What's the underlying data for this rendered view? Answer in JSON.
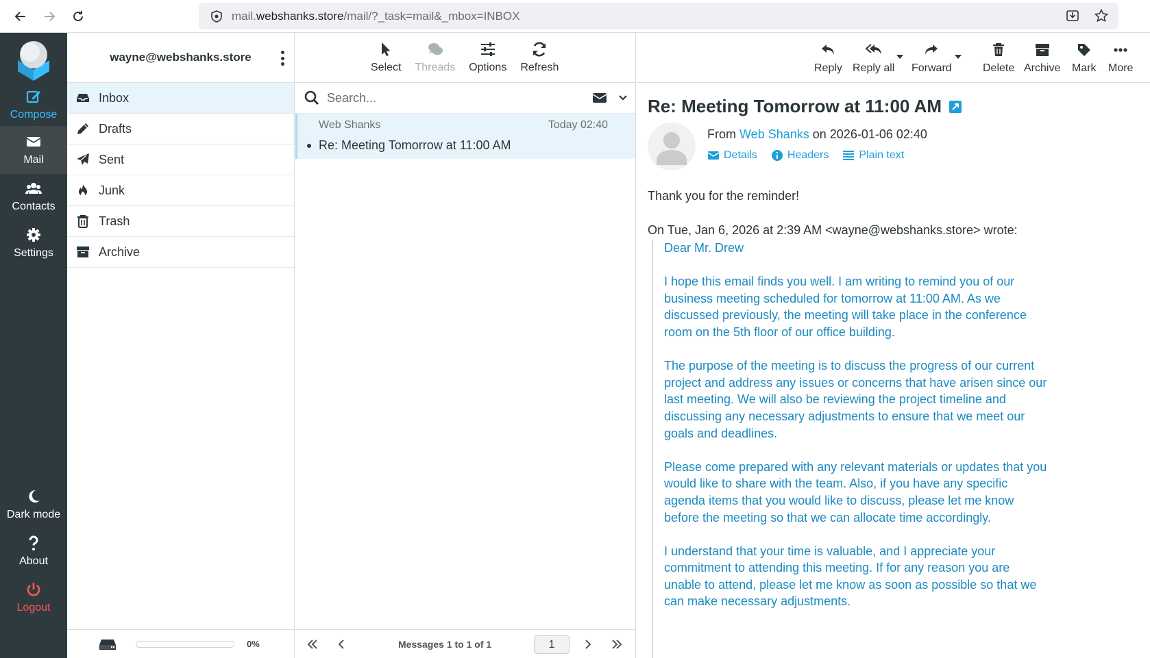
{
  "browser": {
    "url_prefix": "mail.",
    "url_domain": "webshanks.store",
    "url_suffix": "/mail/?_task=mail&_mbox=INBOX"
  },
  "rail": {
    "compose": "Compose",
    "mail": "Mail",
    "contacts": "Contacts",
    "settings": "Settings",
    "dark_mode": "Dark mode",
    "about": "About",
    "logout": "Logout"
  },
  "folders": {
    "account": "wayne@webshanks.store",
    "items": [
      {
        "label": "Inbox",
        "icon": "inbox-icon"
      },
      {
        "label": "Drafts",
        "icon": "pencil-icon"
      },
      {
        "label": "Sent",
        "icon": "paper-plane-icon"
      },
      {
        "label": "Junk",
        "icon": "fire-icon"
      },
      {
        "label": "Trash",
        "icon": "trash-icon"
      },
      {
        "label": "Archive",
        "icon": "archive-icon"
      }
    ],
    "quota_text": "0%",
    "quota_fraction": 0
  },
  "list": {
    "toolbar": {
      "select": "Select",
      "threads": "Threads",
      "options": "Options",
      "refresh": "Refresh"
    },
    "search_placeholder": "Search...",
    "messages": [
      {
        "from": "Web Shanks",
        "date": "Today 02:40",
        "subject": "Re: Meeting Tomorrow at 11:00 AM"
      }
    ],
    "pager_text": "Messages 1 to 1 of 1",
    "page": "1"
  },
  "view": {
    "toolbar": {
      "reply": "Reply",
      "reply_all": "Reply all",
      "forward": "Forward",
      "delete": "Delete",
      "archive": "Archive",
      "mark": "Mark",
      "more": "More"
    },
    "subject": "Re: Meeting Tomorrow at 11:00 AM",
    "from_prefix": "From",
    "from_name": "Web Shanks",
    "from_suffix": "on 2026-01-06 02:40",
    "links": {
      "details": "Details",
      "headers": "Headers",
      "plain_text": "Plain text"
    },
    "body": "Thank you for the reminder!",
    "quote_intro": "On Tue, Jan 6, 2026 at 2:39 AM <wayne@webshanks.store> wrote:",
    "quote": {
      "greeting": "Dear Mr. Drew",
      "p1": "I hope this email finds you well. I am writing to remind you of our business meeting scheduled for tomorrow at 11:00 AM. As we discussed previously, the meeting will take place in the conference room on the 5th floor of our office building.",
      "p2": "The purpose of the meeting is to discuss the progress of our current project and address any issues or concerns that have arisen since our last meeting. We will also be reviewing the project timeline and discussing any necessary adjustments to ensure that we meet our goals and deadlines.",
      "p3": "Please come prepared with any relevant materials or updates that you would like to share with the team. Also, if you have any specific agenda items that you would like to discuss, please let me know before the meeting so that we can allocate time accordingly.",
      "p4": "I understand that your time is valuable, and I appreciate your commitment to attending this meeting. If for any reason you are unable to attend, please let me know as soon as possible so that we can make necessary adjustments."
    }
  },
  "colors": {
    "rail_bg": "#2f3a3f",
    "accent": "#37beff",
    "link": "#1d9fd8",
    "quote": "#1c8ac0",
    "logout": "#ff5552",
    "selected_bg": "#e8f4fb"
  }
}
